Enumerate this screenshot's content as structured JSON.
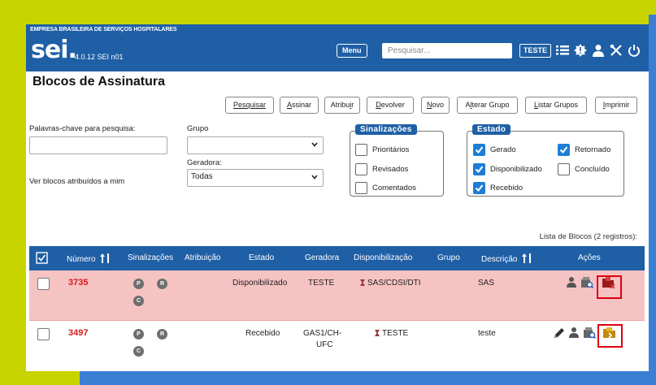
{
  "header": {
    "org": "EMPRESA BRASILEIRA DE SERVIÇOS HOSPITALARES",
    "logo": "sei",
    "logo_dot": ".",
    "version": "4.0.12 SEI n01",
    "menu_label": "Menu",
    "search_placeholder": "Pesquisar...",
    "unit": "TESTE",
    "icons": [
      "search-icon",
      "list-icon",
      "alert-icon",
      "user-icon",
      "tools-icon",
      "power-icon"
    ]
  },
  "page": {
    "title": "Blocos de Assinatura"
  },
  "toolbar": {
    "buttons": [
      {
        "pre": "",
        "ul": "P",
        "post": "esquisar"
      },
      {
        "pre": "",
        "ul": "A",
        "post": "ssinar"
      },
      {
        "pre": "Atribu",
        "ul": "i",
        "post": "r"
      },
      {
        "pre": "",
        "ul": "D",
        "post": "evolver"
      },
      {
        "pre": "",
        "ul": "N",
        "post": "ovo"
      },
      {
        "pre": "A",
        "ul": "l",
        "post": "terar Grupo"
      },
      {
        "pre": "",
        "ul": "L",
        "post": "istar Grupos"
      },
      {
        "pre": "",
        "ul": "I",
        "post": "mprimir"
      }
    ]
  },
  "filters": {
    "keywords_label": "Palavras-chave para pesquisa:",
    "keywords_value": "",
    "assigned_label": "Ver blocos atribuídos a mim",
    "group_label": "Grupo",
    "group_value": "",
    "generator_label": "Geradora:",
    "generator_value": "Todas"
  },
  "flags": {
    "legend": "Sinalizações",
    "items": [
      {
        "label": "Prioritários",
        "checked": false
      },
      {
        "label": "Revisados",
        "checked": false
      },
      {
        "label": "Comentados",
        "checked": false
      }
    ]
  },
  "state": {
    "legend": "Estado",
    "items": [
      {
        "label": "Gerado",
        "checked": true
      },
      {
        "label": "Retornado",
        "checked": true
      },
      {
        "label": "Disponibilizado",
        "checked": true
      },
      {
        "label": "Concluído",
        "checked": false
      },
      {
        "label": "Recebido",
        "checked": true
      }
    ]
  },
  "table": {
    "caption": "Lista de Blocos (2 registros):",
    "headers": [
      "Número",
      "Sinalizações",
      "Atribuição",
      "Estado",
      "Geradora",
      "Disponibilização",
      "Grupo",
      "Descrição",
      "Ações"
    ],
    "rows": [
      {
        "number": "3735",
        "badges": [
          "P",
          "R",
          "C"
        ],
        "assignment": "",
        "state": "Disponibilizado",
        "generator": "TESTE",
        "availability": "SAS/CDSI/DTI",
        "group": "",
        "description": "SAS",
        "highlight": true
      },
      {
        "number": "3497",
        "badges": [
          "P",
          "R",
          "C"
        ],
        "assignment": "",
        "state": "Recebido",
        "generator": "GAS1/CH-",
        "generator2": "UFC",
        "availability": "TESTE",
        "group": "",
        "description": "teste",
        "highlight": false
      }
    ]
  },
  "colors": {
    "brand_blue": "#1f5fa6",
    "accent_lime": "#c8d400",
    "row_highlight": "#f6c3c3",
    "number_red": "#d71a1a",
    "checkbox_blue": "#1e7dd4"
  }
}
